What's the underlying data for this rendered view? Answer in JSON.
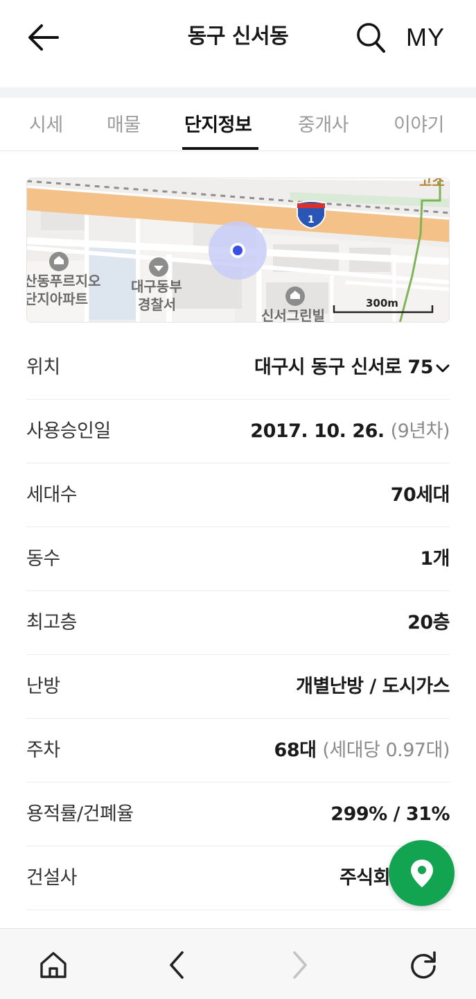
{
  "header": {
    "title": "동구 신서동",
    "back_icon": "arrow-left-icon",
    "search_icon": "search-icon",
    "my_label": "MY"
  },
  "tabs": [
    {
      "label": "시세",
      "active": false
    },
    {
      "label": "매물",
      "active": false
    },
    {
      "label": "단지정보",
      "active": true
    },
    {
      "label": "중개사",
      "active": false
    },
    {
      "label": "이야기",
      "active": false
    }
  ],
  "map": {
    "labels": {
      "apt_left_line1": "산동푸르지오",
      "apt_left_line2": "단지아파트",
      "police_line1": "대구동부",
      "police_line2": "경찰서",
      "villa": "신서그린빌",
      "top_right": "고소",
      "highway_number": "1",
      "scale": "300m"
    },
    "colors": {
      "highway": "#f4c189",
      "marker": "#3b4fe0",
      "marker_halo": "#c8cdf7",
      "rail": "#9aa66a"
    }
  },
  "info_rows": [
    {
      "label": "위치",
      "value": "대구시 동구 신서로 75",
      "sub": "",
      "has_chevron": true
    },
    {
      "label": "사용승인일",
      "value": "2017. 10. 26.",
      "sub": "(9년차)",
      "has_chevron": false
    },
    {
      "label": "세대수",
      "value": "70세대",
      "sub": "",
      "has_chevron": false
    },
    {
      "label": "동수",
      "value": "1개",
      "sub": "",
      "has_chevron": false
    },
    {
      "label": "최고층",
      "value": "20층",
      "sub": "",
      "has_chevron": false
    },
    {
      "label": "난방",
      "value": "개별난방 / 도시가스",
      "sub": "",
      "has_chevron": false
    },
    {
      "label": "주차",
      "value": "68대",
      "sub": "(세대당 0.97대)",
      "has_chevron": false
    },
    {
      "label": "용적률/건폐율",
      "value": "299% / 31%",
      "sub": "",
      "has_chevron": false
    },
    {
      "label": "건설사",
      "value": "주식회",
      "sub": "",
      "has_chevron": false
    }
  ],
  "fab": {
    "icon": "map-pin-icon",
    "color": "#13a451"
  },
  "bottom_bar": {
    "home_icon": "home-icon",
    "back_icon": "chevron-left-icon",
    "forward_icon": "chevron-right-icon",
    "refresh_icon": "refresh-icon"
  }
}
